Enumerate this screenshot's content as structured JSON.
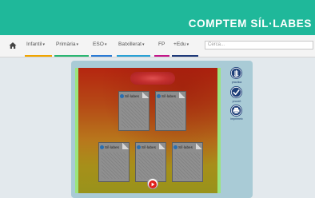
{
  "header": {
    "site_title": "COMPTEM SÍL·LABES",
    "background_color": "#1fb89a"
  },
  "nav": {
    "home_icon": "home-icon",
    "items": [
      {
        "label": "Infantil",
        "color": "#f0a500"
      },
      {
        "label": "Primària",
        "color": "#2bb673"
      },
      {
        "label": "ESO",
        "color": "#2a7bd5"
      },
      {
        "label": "Batxillerat",
        "color": "#2aa1d5"
      },
      {
        "label": "FP",
        "color": "#c2178a"
      },
      {
        "label": "+Edu",
        "color": "#1e3a7a"
      }
    ],
    "search_placeholder": "Cerca..."
  },
  "game": {
    "cards": [
      {
        "label": "Síl·labes"
      },
      {
        "label": "Síl·labes"
      },
      {
        "label": "Síl·labes"
      },
      {
        "label": "Síl·labes"
      },
      {
        "label": "Síl·labes"
      }
    ],
    "play_icon": "play-icon"
  },
  "sidebar": {
    "buttons": [
      {
        "label": "practica",
        "icon": "hand-icon"
      },
      {
        "label": "prova't",
        "icon": "check-icon"
      },
      {
        "label": "imprimeix",
        "icon": "printer-icon"
      }
    ]
  }
}
